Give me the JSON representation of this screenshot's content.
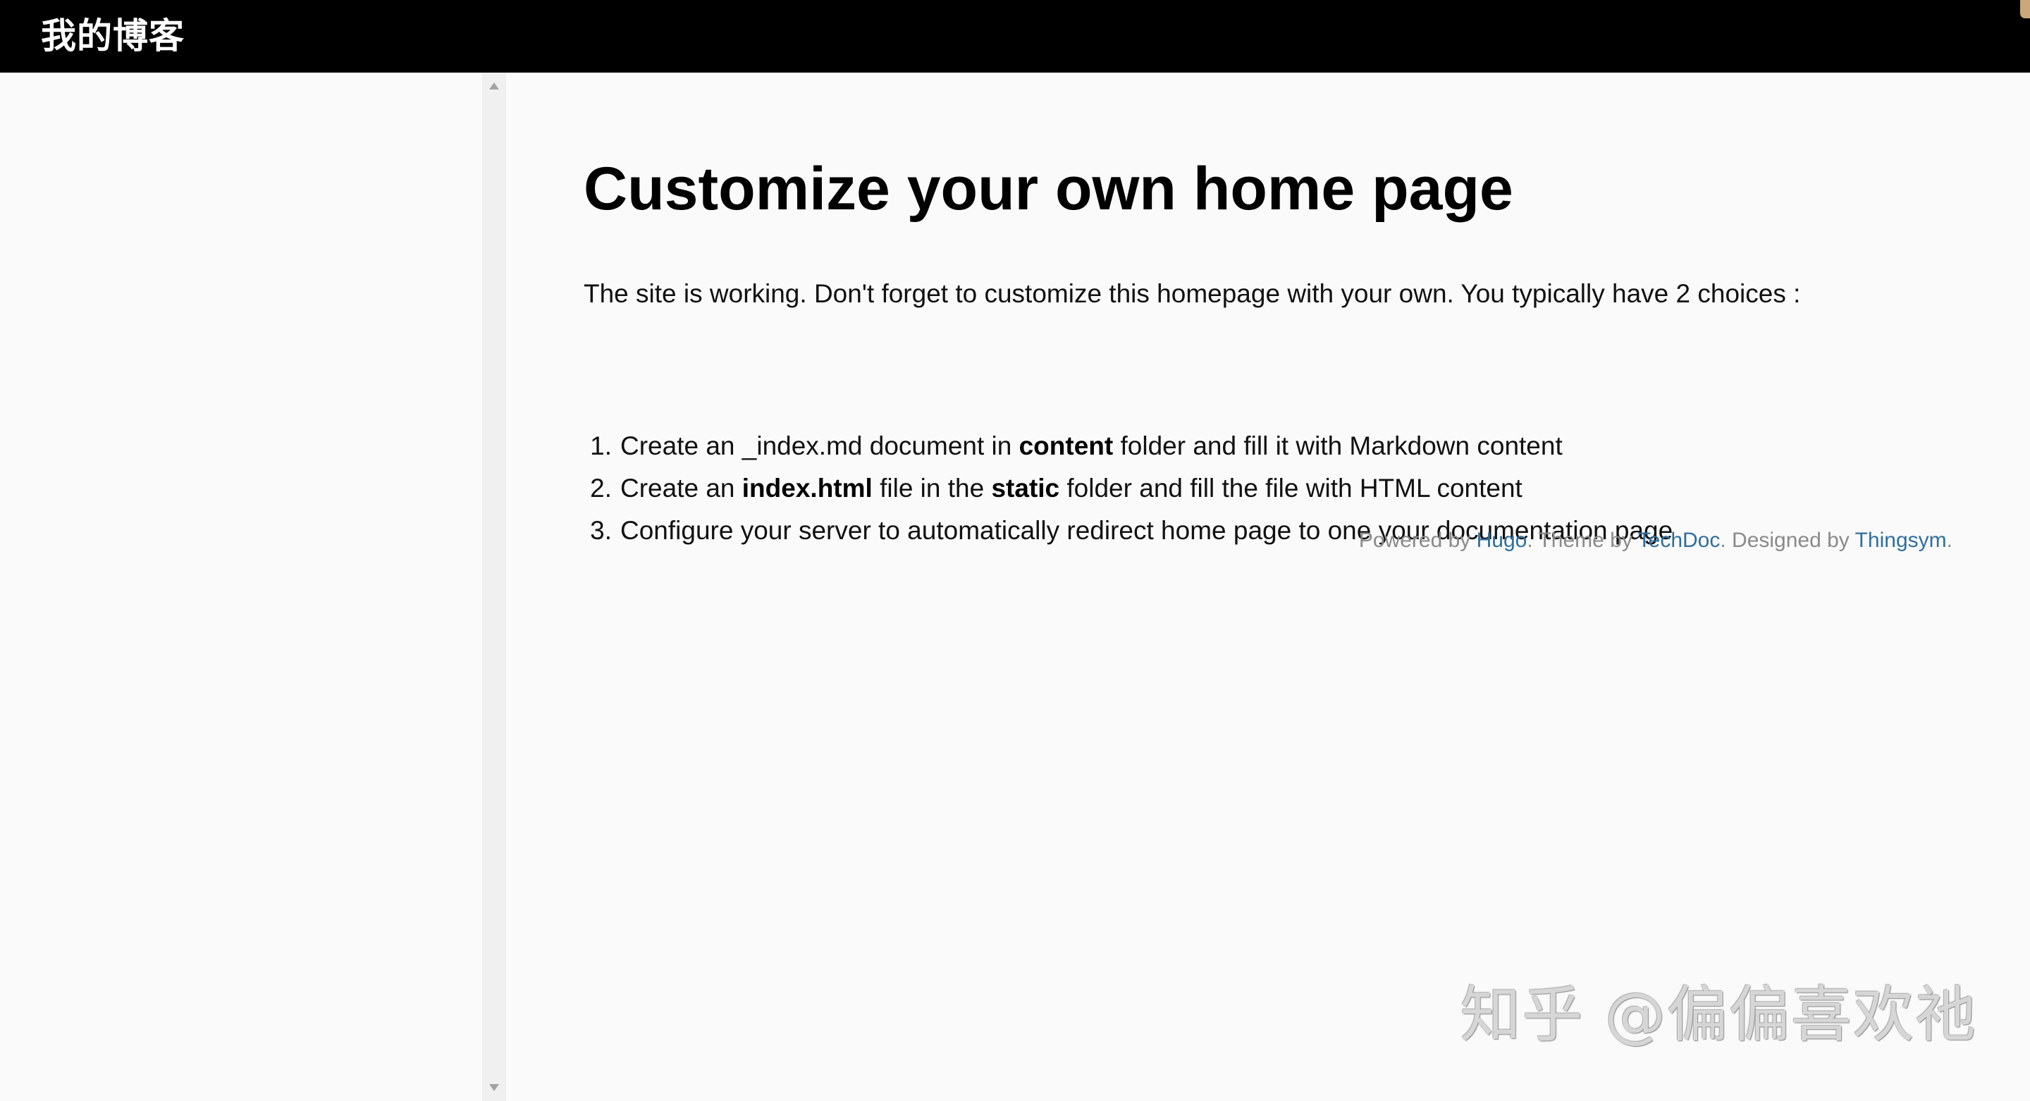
{
  "header": {
    "site_title": "我的博客"
  },
  "main": {
    "title": "Customize your own home page",
    "intro": "The site is working. Don't forget to customize this homepage with your own. You typically have 2 choices :",
    "choices": [
      {
        "number": "1.",
        "parts": [
          "Create an _index.md document in ",
          "content",
          " folder and fill it with Markdown content"
        ]
      },
      {
        "number": "2.",
        "parts": [
          "Create an ",
          "index.html",
          " file in the ",
          "static",
          " folder and fill the file with HTML content"
        ]
      },
      {
        "number": "3.",
        "parts": [
          "Configure your server to automatically redirect home page to one your documentation page"
        ]
      }
    ]
  },
  "footer": {
    "powered_prefix": "Powered by ",
    "powered_link": "Hugo",
    "theme_prefix": ". Theme by ",
    "theme_link": "TechDoc",
    "designed_prefix": ". Designed by ",
    "designed_link": "Thingsym",
    "suffix": "."
  },
  "watermark": {
    "text": "知乎 @偏偏喜欢祂"
  },
  "colors": {
    "header_bg": "#000000",
    "page_bg": "#fafafa",
    "link": "#2f6f9f",
    "footer_text": "#8a8a8a"
  },
  "icons": {
    "scroll_up": "triangle-up-icon",
    "scroll_down": "triangle-down-icon"
  }
}
